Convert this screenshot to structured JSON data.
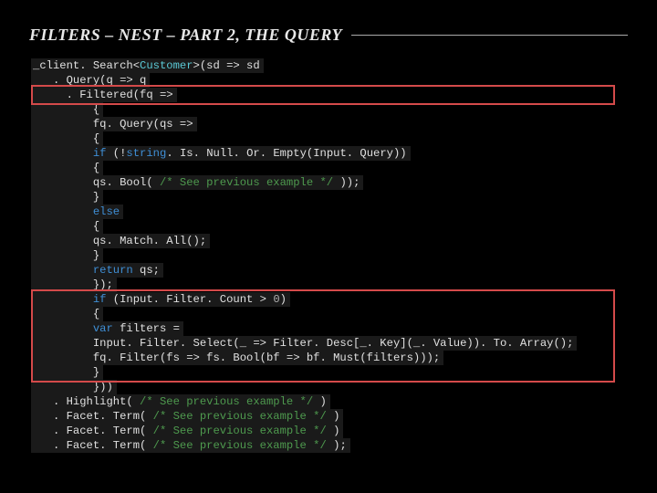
{
  "title": "FILTERS – NEST – PART 2, THE QUERY",
  "code": {
    "l01a": "_client. Search<",
    "l01b": "Customer",
    "l01c": ">(sd => sd",
    "l02": "   . Query(q => q",
    "l03": "     . Filtered(fq =>",
    "l04": "         {",
    "l05": "         fq. Query(qs =>",
    "l06": "         {",
    "l07a": "         ",
    "l07b": "if",
    "l07c": " (!",
    "l07d": "string",
    "l07e": ". Is. Null. Or. Empty(Input. Query))",
    "l08": "         {",
    "l09a": "         qs. Bool( ",
    "l09b": "/* See previous example */",
    "l09c": " ));",
    "l10": "         }",
    "l11a": "         ",
    "l11b": "else",
    "l12": "         {",
    "l13": "         qs. Match. All();",
    "l14": "         }",
    "l15a": "         ",
    "l15b": "return",
    "l15c": " qs;",
    "l16": "         });",
    "l17a": "         ",
    "l17b": "if",
    "l17c": " (Input. Filter. Count > ",
    "l17d": "0",
    "l17e": ")",
    "l18": "         {",
    "l19a": "         ",
    "l19b": "var",
    "l19c": " filters =",
    "l20": "         Input. Filter. Select(_ => Filter. Desc[_. Key](_. Value)). To. Array();",
    "l21": "         fq. Filter(fs => fs. Bool(bf => bf. Must(filters)));",
    "l22": "         }",
    "l23": "         }))",
    "l24a": "   . Highlight( ",
    "l24b": "/* See previous example */",
    "l24c": " )",
    "l25a": "   . Facet. Term( ",
    "l25b": "/* See previous example */",
    "l25c": " )",
    "l26a": "   . Facet. Term( ",
    "l26b": "/* See previous example */",
    "l26c": " )",
    "l27a": "   . Facet. Term( ",
    "l27b": "/* See previous example */",
    "l27c": " );"
  }
}
